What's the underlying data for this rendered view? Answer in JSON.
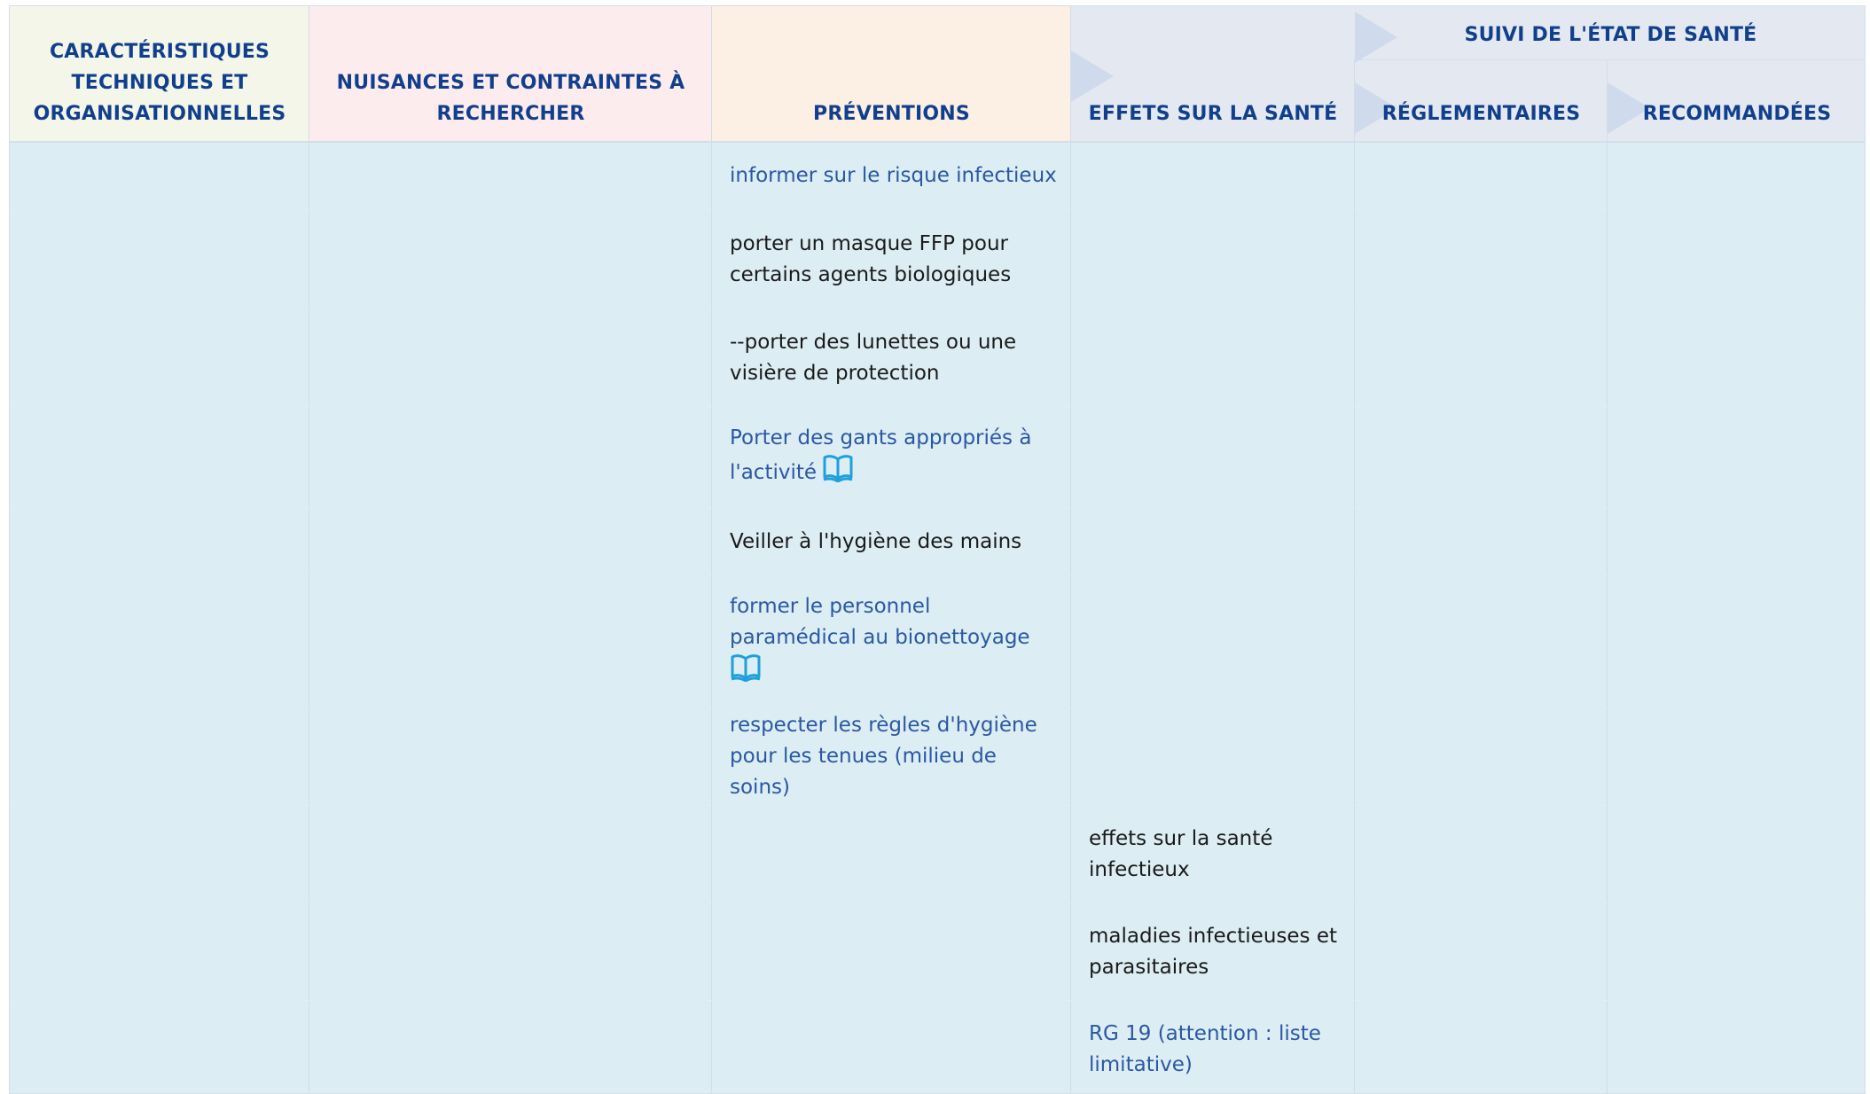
{
  "header": {
    "col1": [
      "CARACTÉRISTIQUES",
      "TECHNIQUES ET",
      "ORGANISATIONNELLES"
    ],
    "col2": [
      "NUISANCES ET CONTRAINTES À",
      "RECHERCHER"
    ],
    "col3": "PRÉVENTIONS",
    "col4": "EFFETS SUR LA SANTÉ",
    "group": "SUIVI DE L'ÉTAT DE SANTÉ",
    "col5": "RÉGLEMENTAIRES",
    "col6": "RECOMMANDÉES"
  },
  "preventions": [
    {
      "text": "informer sur le risque infectieux",
      "style": "link"
    },
    {
      "text": "porter un masque FFP pour certains agents biologiques",
      "style": "plain"
    },
    {
      "text": "--porter des lunettes ou une visière de protection",
      "style": "plain"
    },
    {
      "text": "Porter des gants appropriés à l'activité",
      "style": "link",
      "icon": "book-icon"
    },
    {
      "text": "Veiller à l'hygiène des mains",
      "style": "plain"
    },
    {
      "text": "former le personnel paramédical au bionettoyage",
      "style": "link",
      "icon": "book-icon"
    },
    {
      "text": "respecter les règles d'hygiène pour les tenues (milieu de soins)",
      "style": "link"
    }
  ],
  "effets": [
    {
      "text": "effets sur la santé infectieux",
      "style": "plain"
    },
    {
      "text": "maladies infectieuses et parasitaires",
      "style": "plain"
    },
    {
      "text": "RG 19 (attention : liste limitative)",
      "style": "link"
    }
  ],
  "colors": {
    "header_text": "#123f8c",
    "link": "#2a58a2",
    "icon": "#1ea0dc",
    "body_bg": "#dcedf4"
  }
}
